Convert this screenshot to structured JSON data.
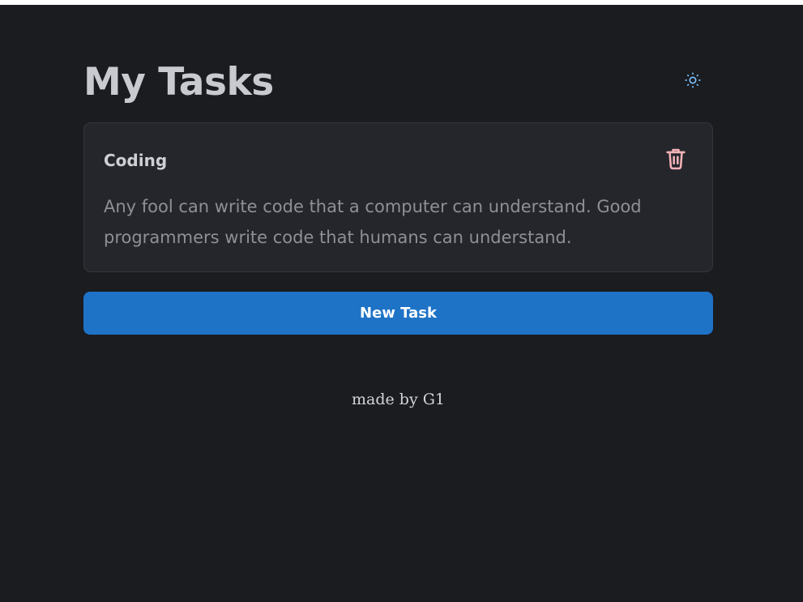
{
  "header": {
    "title": "My Tasks",
    "theme_toggle_icon": "sun-icon"
  },
  "tasks": [
    {
      "title": "Coding",
      "body": "Any fool can write code that a computer can understand. Good programmers write code that humans can understand.",
      "delete_icon": "trash-icon"
    }
  ],
  "actions": {
    "new_task_label": "New Task"
  },
  "footer": {
    "text": "made by G1"
  },
  "colors": {
    "background": "#1b1c20",
    "card": "#25262b",
    "accent": "#1e73c6",
    "delete_icon": "#f4b3b8",
    "sun_icon": "#7cc2ff"
  }
}
